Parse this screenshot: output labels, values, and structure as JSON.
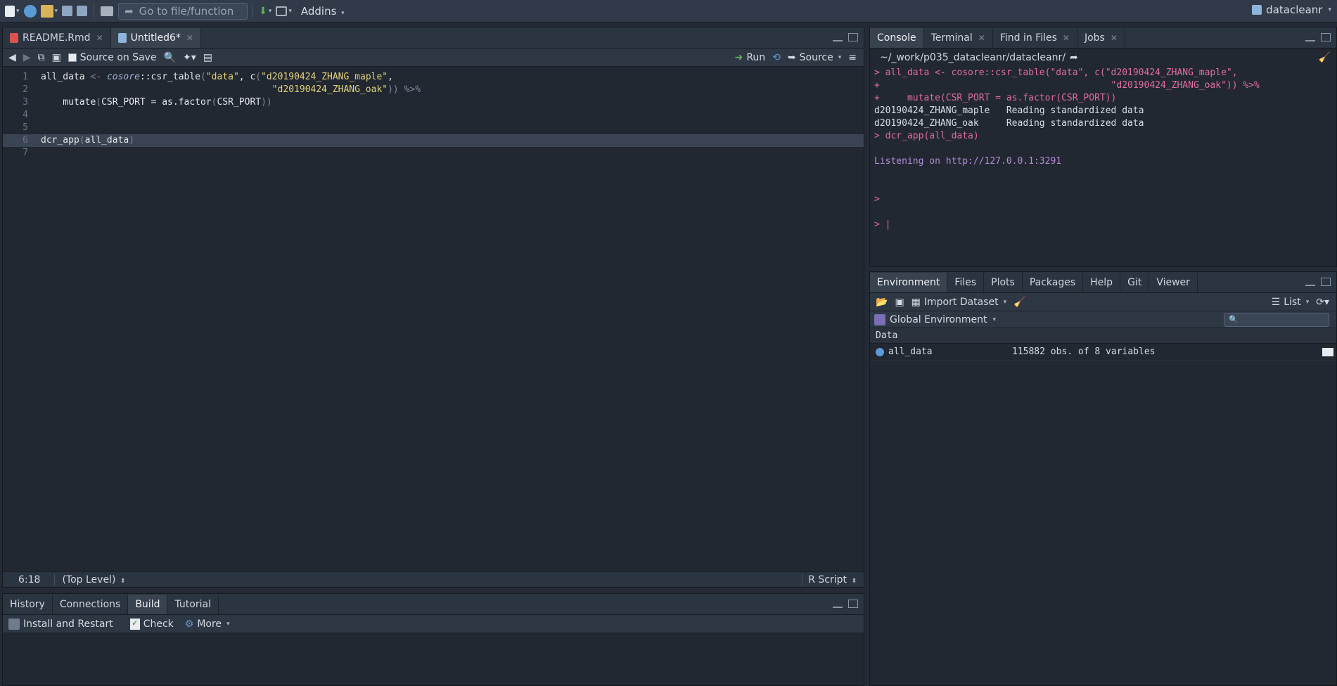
{
  "toolbar": {
    "goto_placeholder": "Go to file/function",
    "addins": "Addins",
    "project": "datacleanr"
  },
  "source_pane": {
    "tabs": [
      {
        "label": "README.Rmd"
      },
      {
        "label": "Untitled6*"
      }
    ],
    "source_on_save": "Source on Save",
    "run": "Run",
    "source": "Source",
    "lines": [
      {
        "n": "1",
        "t": [
          [
            "fn",
            "all_data "
          ],
          [
            "op",
            "<- "
          ],
          [
            "ns",
            "cosore"
          ],
          [
            "fn",
            "::csr_table"
          ],
          [
            "op",
            "("
          ],
          [
            "str",
            "\"data\""
          ],
          [
            "fn",
            ", c"
          ],
          [
            "op",
            "("
          ],
          [
            "str",
            "\"d20190424_ZHANG_maple\""
          ],
          [
            "fn",
            ","
          ]
        ]
      },
      {
        "n": "2",
        "t": [
          [
            "fn",
            "                                          "
          ],
          [
            "str",
            "\"d20190424_ZHANG_oak\""
          ],
          [
            "op",
            "))"
          ],
          [
            "fn",
            " "
          ],
          [
            "op",
            "%>%"
          ]
        ]
      },
      {
        "n": "3",
        "t": [
          [
            "fn",
            "    mutate"
          ],
          [
            "op",
            "("
          ],
          [
            "fn",
            "CSR_PORT = as.factor"
          ],
          [
            "op",
            "("
          ],
          [
            "fn",
            "CSR_PORT"
          ],
          [
            "op",
            "))"
          ]
        ]
      },
      {
        "n": "4",
        "t": []
      },
      {
        "n": "5",
        "t": []
      },
      {
        "n": "6",
        "t": [
          [
            "fn",
            "dcr_app"
          ],
          [
            "op",
            "("
          ],
          [
            "fn",
            "all_data"
          ],
          [
            "op",
            ")"
          ]
        ]
      },
      {
        "n": "7",
        "t": []
      }
    ],
    "status": {
      "pos": "6:18",
      "scope": "(Top Level)",
      "type": "R Script"
    }
  },
  "build_pane": {
    "tabs": [
      "History",
      "Connections",
      "Build",
      "Tutorial"
    ],
    "install": "Install and Restart",
    "check": "Check",
    "more": "More"
  },
  "console_pane": {
    "tabs": [
      "Console",
      "Terminal",
      "Find in Files",
      "Jobs"
    ],
    "path": "~/_work/p035_datacleanr/datacleanr/",
    "lines": [
      {
        "c": "pink",
        "t": "> all_data <- cosore::csr_table(\"data\", c(\"d20190424_ZHANG_maple\","
      },
      {
        "c": "pink",
        "t": "+                                          \"d20190424_ZHANG_oak\")) %>%"
      },
      {
        "c": "pink",
        "t": "+     mutate(CSR_PORT = as.factor(CSR_PORT))"
      },
      {
        "c": "plain",
        "t": "d20190424_ZHANG_maple   Reading standardized data"
      },
      {
        "c": "plain",
        "t": "d20190424_ZHANG_oak     Reading standardized data"
      },
      {
        "c": "pink",
        "t": "> dcr_app(all_data)"
      },
      {
        "c": "plain",
        "t": ""
      },
      {
        "c": "purple",
        "t": "Listening on http://127.0.0.1:3291"
      },
      {
        "c": "plain",
        "t": ""
      },
      {
        "c": "plain",
        "t": ""
      },
      {
        "c": "pink",
        "t": ">"
      },
      {
        "c": "plain",
        "t": ""
      },
      {
        "c": "pink",
        "t": "> |"
      }
    ]
  },
  "env_pane": {
    "tabs": [
      "Environment",
      "Files",
      "Plots",
      "Packages",
      "Help",
      "Git",
      "Viewer"
    ],
    "import": "Import Dataset",
    "list": "List",
    "scope": "Global Environment",
    "section": "Data",
    "rows": [
      {
        "name": "all_data",
        "value": "115882 obs. of 8 variables"
      }
    ]
  }
}
